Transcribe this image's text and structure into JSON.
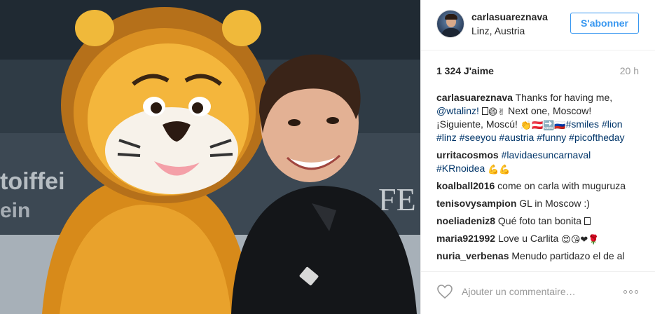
{
  "post": {
    "username": "carlasuareznava",
    "location": "Linz, Austria",
    "follow_label": "S'abonner",
    "likes": "1 324 J'aime",
    "time_ago": "20 h"
  },
  "caption": {
    "user": "carlasuareznava",
    "text_1": "Thanks for having me,",
    "mention": "@wtalinz!",
    "text_2": "Next one, Moscow! ¡Siguiente, Moscú!",
    "tags": [
      "#smiles",
      "#lion",
      "#linz",
      "#seeyou",
      "#austria",
      "#funny",
      "#picoftheday"
    ]
  },
  "comments": [
    {
      "user": "urritacosmos",
      "tags": [
        "#lavidaesuncarnaval",
        "#KRnoidea"
      ],
      "text": ""
    },
    {
      "user": "koalball2016",
      "text": "come on carla with muguruza"
    },
    {
      "user": "tenisovysampion",
      "text": "GL in Moscow :)"
    },
    {
      "user": "noeliadeniz8",
      "text": "Qué foto tan bonita"
    },
    {
      "user": "maria921992",
      "text": "Love u Carlita"
    },
    {
      "user": "nuria_verbenas",
      "text": "Menudo partidazo el de al"
    }
  ],
  "footer": {
    "comment_placeholder": "Ajouter un commentaire…"
  },
  "icons": {
    "like": "heart-icon",
    "more": "more-options-icon",
    "avatar": "profile-avatar"
  },
  "colors": {
    "accent": "#3897f0",
    "hashtag": "#003569",
    "muted": "#999999",
    "border": "#efefef"
  }
}
